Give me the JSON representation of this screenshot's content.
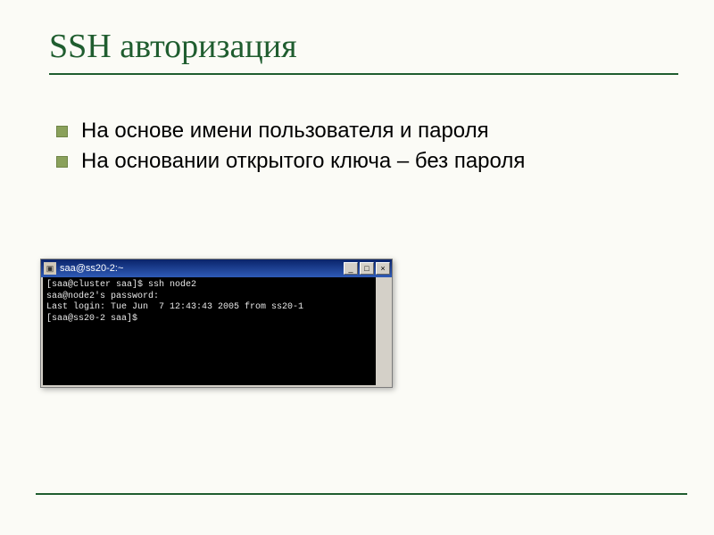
{
  "slide": {
    "title": "SSH авторизация",
    "bullets": [
      "На основе имени пользователя и пароля",
      "На основании открытого ключа – без пароля"
    ]
  },
  "terminal": {
    "title": "saa@ss20-2:~",
    "lines": [
      "[saa@cluster saa]$ ssh node2",
      "saa@node2's password:",
      "Last login: Tue Jun  7 12:43:43 2005 from ss20-1",
      "[saa@ss20-2 saa]$"
    ],
    "buttons": {
      "min": "_",
      "max": "□",
      "close": "×"
    },
    "scroll": {
      "up": "▴",
      "down": "▾"
    }
  }
}
